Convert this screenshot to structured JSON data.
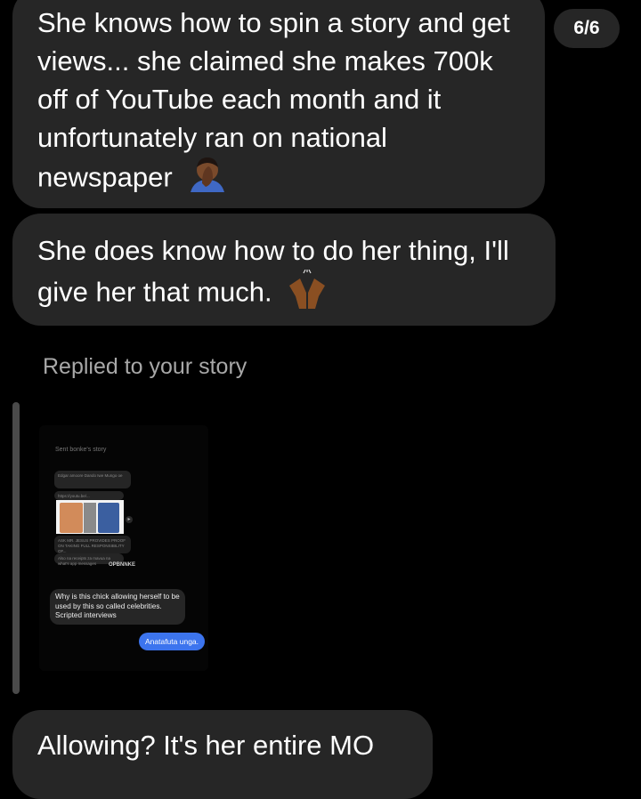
{
  "messages": [
    {
      "text": "She knows how to spin a story and get views... she claimed she makes 700k off of YouTube each month and it unfortunately ran on national newspaper",
      "emoji": "man-facepalming"
    },
    {
      "text": "She does know how to do her thing, I'll give her that much.",
      "emoji": "raising-hands"
    },
    {
      "text": "Allowing? It's her entire MO"
    }
  ],
  "counter": "6/6",
  "reply": {
    "label": "Replied to your story",
    "story": {
      "sent_text": "Sent bonke's story",
      "card1": "Edgar amoore Dando Iwe Mungo oe",
      "card2": "https://youtu.be/...",
      "card3": "ASK MR. JESUS PROVIDES PROOF ON TAKING FULL RESPONSIBILITY OF...",
      "card4": "Also na receipts za mavua na what's app messages",
      "brand": "OPBNNKE",
      "gray_message": "Why is this chick allowing herself to be used by this so called celebrities. Scripted interviews",
      "blue_message": "Anatafuta unga."
    }
  }
}
